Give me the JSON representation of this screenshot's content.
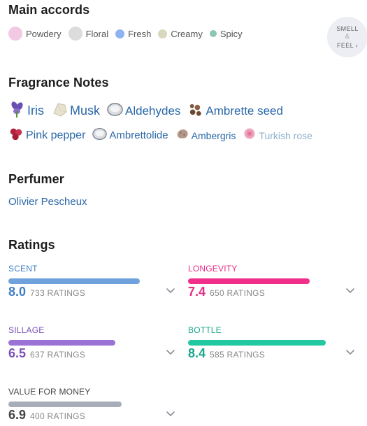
{
  "main_accords": {
    "title": "Main accords",
    "items": [
      {
        "label": "Powdery",
        "color": "#f3c8e3",
        "size": 20
      },
      {
        "label": "Floral",
        "color": "#dcdcdc",
        "size": 20
      },
      {
        "label": "Fresh",
        "color": "#8fb3f1",
        "size": 13
      },
      {
        "label": "Creamy",
        "color": "#d9d7be",
        "size": 13
      },
      {
        "label": "Spicy",
        "color": "#8fc5b6",
        "size": 10
      }
    ],
    "smell_feel": {
      "line1": "SMELL",
      "amp": "&",
      "line2": "FEEL",
      "arrow": "›"
    }
  },
  "fragrance_notes": {
    "title": "Fragrance Notes",
    "rows": [
      [
        {
          "label": "Iris",
          "icon": "iris-flower-icon",
          "color": "#6b4fb3",
          "font": 18
        },
        {
          "label": "Musk",
          "icon": "musk-crystal-icon",
          "color": "#e7e2cf",
          "font": 18
        },
        {
          "label": "Aldehydes",
          "icon": "aldehydes-icon",
          "color": "#b0b5ba",
          "font": 17
        },
        {
          "label": "Ambrette seed",
          "icon": "ambrette-seed-icon",
          "color": "#6b4a34",
          "font": 17
        }
      ],
      [
        {
          "label": "Pink pepper",
          "icon": "pink-pepper-icon",
          "color": "#b3223d",
          "font": 16
        },
        {
          "label": "Ambrettolide",
          "icon": "ambrettolide-icon",
          "color": "#b0b5ba",
          "font": 15
        },
        {
          "label": "Ambergris",
          "icon": "ambergris-icon",
          "color": "#b39688",
          "font": 14
        },
        {
          "label": "Turkish rose",
          "icon": "turkish-rose-icon",
          "color": "#f0a6bf",
          "font": 14,
          "faded": true
        }
      ]
    ]
  },
  "perfumer": {
    "title": "Perfumer",
    "name": "Olivier Pescheux"
  },
  "ratings": {
    "title": "Ratings",
    "items": [
      {
        "name": "SCENT",
        "value": "8.0",
        "count": "733 RATINGS",
        "color": "#3f7fc6",
        "bar": "#6fa2dc",
        "fill": 0.8
      },
      {
        "name": "LONGEVITY",
        "value": "7.4",
        "count": "650 RATINGS",
        "color": "#e52c86",
        "bar": "#f12f8b",
        "fill": 0.74
      },
      {
        "name": "SILLAGE",
        "value": "6.5",
        "count": "637 RATINGS",
        "color": "#7b4fb8",
        "bar": "#9b72d6",
        "fill": 0.65
      },
      {
        "name": "BOTTLE",
        "value": "8.4",
        "count": "585 RATINGS",
        "color": "#18a78b",
        "bar": "#22c9a0",
        "fill": 0.84
      },
      {
        "name": "VALUE FOR MONEY",
        "value": "6.9",
        "count": "400 RATINGS",
        "color": "#444444",
        "bar": "#a8adba",
        "fill": 0.69
      }
    ]
  }
}
